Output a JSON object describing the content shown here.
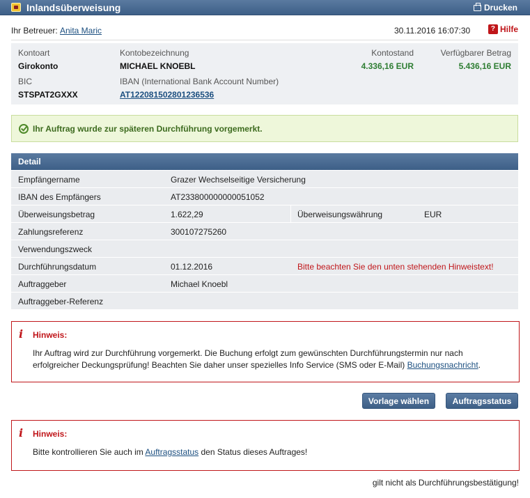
{
  "window": {
    "title": "Inlandsüberweisung",
    "print_label": "Drucken"
  },
  "advisor": {
    "label": "Ihr Betreuer:",
    "name": "Anita Maric",
    "datetime": "30.11.2016 16:07:30",
    "help_label": "Hilfe"
  },
  "account": {
    "type_label": "Kontoart",
    "type_value": "Girokonto",
    "name_label": "Kontobezeichnung",
    "name_value": "MICHAEL KNOEBL",
    "balance_label": "Kontostand",
    "balance_value": "4.336,16 EUR",
    "available_label": "Verfügbarer Betrag",
    "available_value": "5.436,16 EUR",
    "bic_label": "BIC",
    "bic_value": "STSPAT2GXXX",
    "iban_label": "IBAN (International Bank Account Number)",
    "iban_value": "AT122081502801236536"
  },
  "success": {
    "message": "Ihr Auftrag wurde zur späteren Durchführung vorgemerkt."
  },
  "detail": {
    "header": "Detail",
    "rows": {
      "recipient_label": "Empfängername",
      "recipient_value": "Grazer Wechselseitige Versicherung",
      "iban_label": "IBAN des Empfängers",
      "iban_value": "AT233800000000051052",
      "amount_label": "Überweisungsbetrag",
      "amount_value": "1.622,29",
      "currency_label": "Überweisungswährung",
      "currency_value": "EUR",
      "reference_label": "Zahlungsreferenz",
      "reference_value": "300107275260",
      "purpose_label": "Verwendungszweck",
      "date_label": "Durchführungsdatum",
      "date_value": "01.12.2016",
      "date_warning": "Bitte beachten Sie den unten stehenden Hinweistext!",
      "orderer_label": "Auftraggeber",
      "orderer_value": "Michael Knoebl",
      "orderer_ref_label": "Auftraggeber-Referenz"
    }
  },
  "hint1": {
    "title": "Hinweis:",
    "text": "Ihr Auftrag wird zur Durchführung vorgemerkt. Die Buchung erfolgt zum gewünschten Durchführungstermin nur nach erfolgreicher Deckungsprüfung! Beachten Sie daher unser spezielles Info Service (SMS oder E-Mail)",
    "link": "Buchungsnachricht",
    "suffix": "."
  },
  "buttons": {
    "template": "Vorlage wählen",
    "status": "Auftragsstatus"
  },
  "hint2": {
    "title": "Hinweis:",
    "prefix": "Bitte kontrollieren Sie auch im",
    "link": "Auftragsstatus",
    "suffix": "den Status dieses Auftrages!"
  },
  "footer": {
    "note": "gilt nicht als Durchführungsbestätigung!"
  }
}
